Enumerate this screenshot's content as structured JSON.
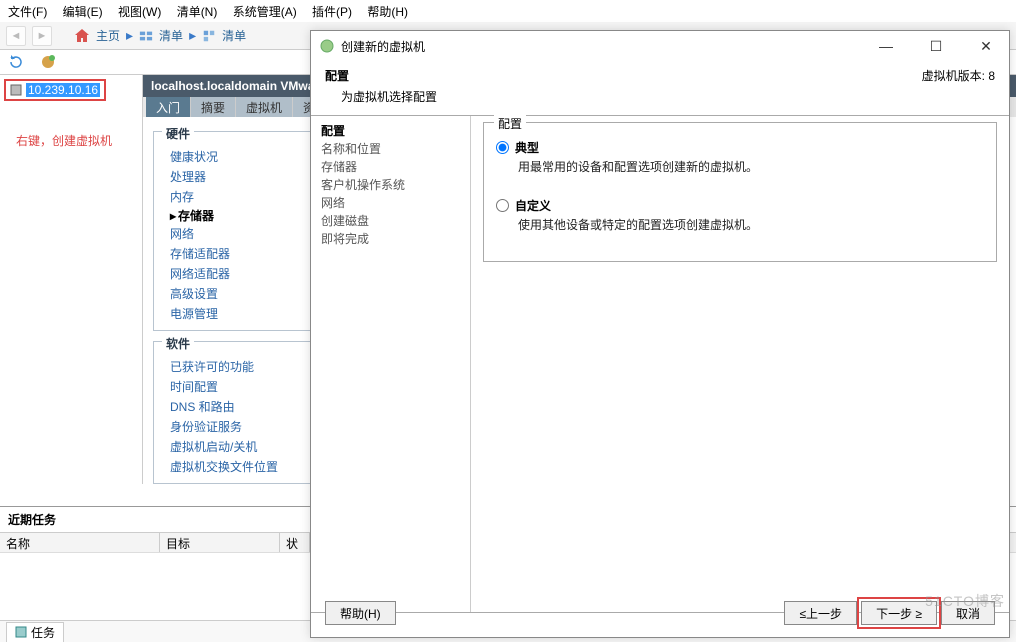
{
  "menubar": [
    "文件(F)",
    "编辑(E)",
    "视图(W)",
    "清单(N)",
    "系统管理(A)",
    "插件(P)",
    "帮助(H)"
  ],
  "breadcrumb": {
    "home": "主页",
    "items": [
      "清单",
      "清单"
    ]
  },
  "tree": {
    "node_ip": "10.239.10.16"
  },
  "annotation": "右键，创建虚拟机",
  "host_title": "localhost.localdomain VMwa",
  "tabs": [
    "入门",
    "摘要",
    "虚拟机",
    "资源"
  ],
  "hardware": {
    "legend": "硬件",
    "items": [
      "健康状况",
      "处理器",
      "内存",
      "存储器",
      "网络",
      "存储适配器",
      "网络适配器",
      "高级设置",
      "电源管理"
    ],
    "selected_index": 3
  },
  "software": {
    "legend": "软件",
    "items": [
      "已获许可的功能",
      "时间配置",
      "DNS 和路由",
      "身份验证服务",
      "虚拟机启动/关机",
      "虚拟机交换文件位置"
    ]
  },
  "tasks": {
    "section_title": "近期任务",
    "cols": [
      "名称",
      "目标",
      "状"
    ]
  },
  "status_tab": "任务",
  "dialog": {
    "title": "创建新的虚拟机",
    "vm_version": "虚拟机版本: 8",
    "header_title": "配置",
    "header_sub": "为虚拟机选择配置",
    "nav": [
      "配置",
      "名称和位置",
      "存储器",
      "客户机操作系统",
      "网络",
      "创建磁盘",
      "即将完成"
    ],
    "nav_active": 0,
    "fieldset": "配置",
    "radio": {
      "typical_label": "典型",
      "typical_desc": "用最常用的设备和配置选项创建新的虚拟机。",
      "custom_label": "自定义",
      "custom_desc": "使用其他设备或特定的配置选项创建虚拟机。"
    },
    "buttons": {
      "help": "帮助(H)",
      "back": "≤上一步",
      "next": "下一步 ≥",
      "cancel": "取消"
    }
  },
  "watermark": "51CTO博客"
}
